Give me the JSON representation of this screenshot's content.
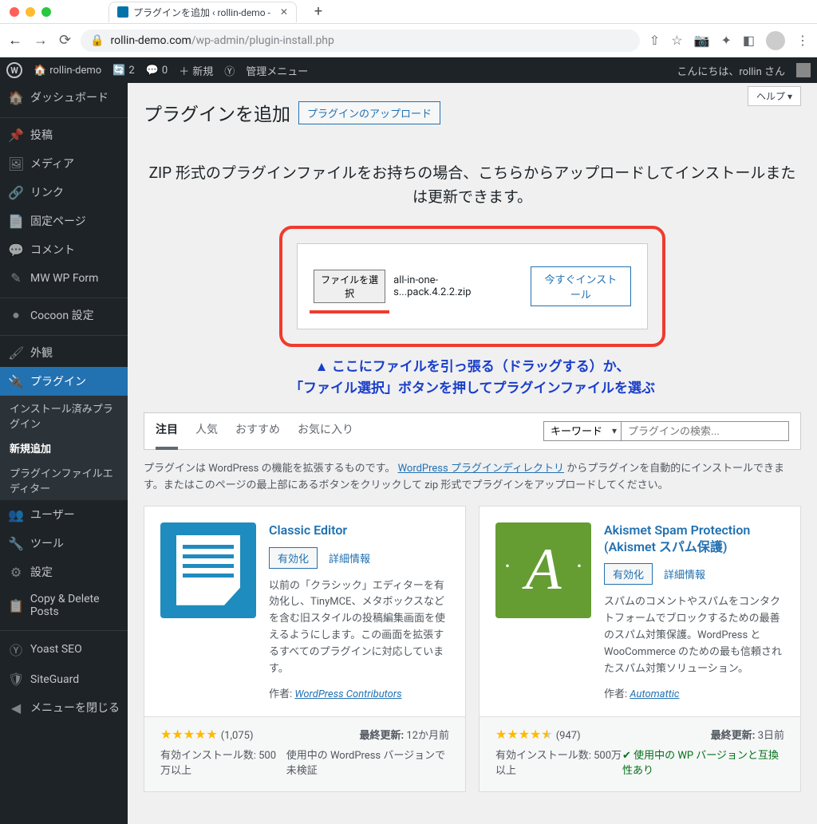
{
  "browser": {
    "tab_title": "プラグインを追加 ‹ rollin-demo -",
    "url_host": "rollin-demo.com",
    "url_path": "/wp-admin/plugin-install.php"
  },
  "adminbar": {
    "site_name": "rollin-demo",
    "updates": "2",
    "comments": "0",
    "new": "新規",
    "admin_menu": "管理メニュー",
    "greeting": "こんにちは、rollin さん"
  },
  "menu": {
    "dashboard": "ダッシュボード",
    "posts": "投稿",
    "media": "メディア",
    "links": "リンク",
    "pages": "固定ページ",
    "comments": "コメント",
    "mwwpform": "MW WP Form",
    "cocoon": "Cocoon 設定",
    "appearance": "外観",
    "plugins": "プラグイン",
    "plugins_sub": {
      "installed": "インストール済みプラグイン",
      "add_new": "新規追加",
      "editor": "プラグインファイルエディター"
    },
    "users": "ユーザー",
    "tools": "ツール",
    "settings": "設定",
    "copy_delete": "Copy & Delete Posts",
    "yoast": "Yoast SEO",
    "siteguard": "SiteGuard",
    "collapse": "メニューを閉じる"
  },
  "page": {
    "heading": "プラグインを追加",
    "upload_button": "プラグインのアップロード",
    "help": "ヘルプ",
    "upload_msg": "ZIP 形式のプラグインファイルをお持ちの場合、こちらからアップロードしてインストールまたは更新できます。",
    "choose_file": "ファイルを選択",
    "filename": "all-in-one-s...pack.4.2.2.zip",
    "install_now": "今すぐインストール",
    "annotation_l1": "▲ ここにファイルを引っ張る（ドラッグする）か、",
    "annotation_l2": "「ファイル選択」ボタンを押してプラグインファイルを選ぶ",
    "filters": {
      "featured": "注目",
      "popular": "人気",
      "recommended": "おすすめ",
      "favorites": "お気に入り"
    },
    "search": {
      "type": "キーワード",
      "placeholder": "プラグインの検索..."
    },
    "helptext_1": "プラグインは WordPress の機能を拡張するものです。",
    "helptext_link": "WordPress プラグインディレクトリ",
    "helptext_2": " からプラグインを自動的にインストールできます。またはこのページの最上部にあるボタンをクリックして zip 形式でプラグインをアップロードしてください。",
    "labels": {
      "activate": "有効化",
      "details": "詳細情報",
      "author_prefix": "作者: ",
      "last_update": "最終更新:",
      "active_installs": "有効インストール数:",
      "compat_untested": "使用中の WordPress バージョンで未検証",
      "compat_ok": "使用中の WP バージョンと互換性あり"
    },
    "plugins": [
      {
        "name": "Classic Editor",
        "desc": "以前の「クラシック」エディターを有効化し、TinyMCE、メタボックスなどを含む旧スタイルの投稿編集画面を使えるようにします。この画面を拡張するすべてのプラグインに対応しています。",
        "author": "WordPress Contributors",
        "rating": "(1,075)",
        "updated": "12か月前",
        "installs": "500万以上"
      },
      {
        "name": "Akismet Spam Protection (Akismet スパム保護)",
        "desc": "スパムのコメントやスパムをコンタクトフォームでブロックするための最善のスパム対策保護。WordPress と WooCommerce のための最も信頼されたスパム対策ソリューション。",
        "author": "Automattic",
        "rating": "(947)",
        "updated": "3日前",
        "installs": "500万以上"
      }
    ]
  }
}
